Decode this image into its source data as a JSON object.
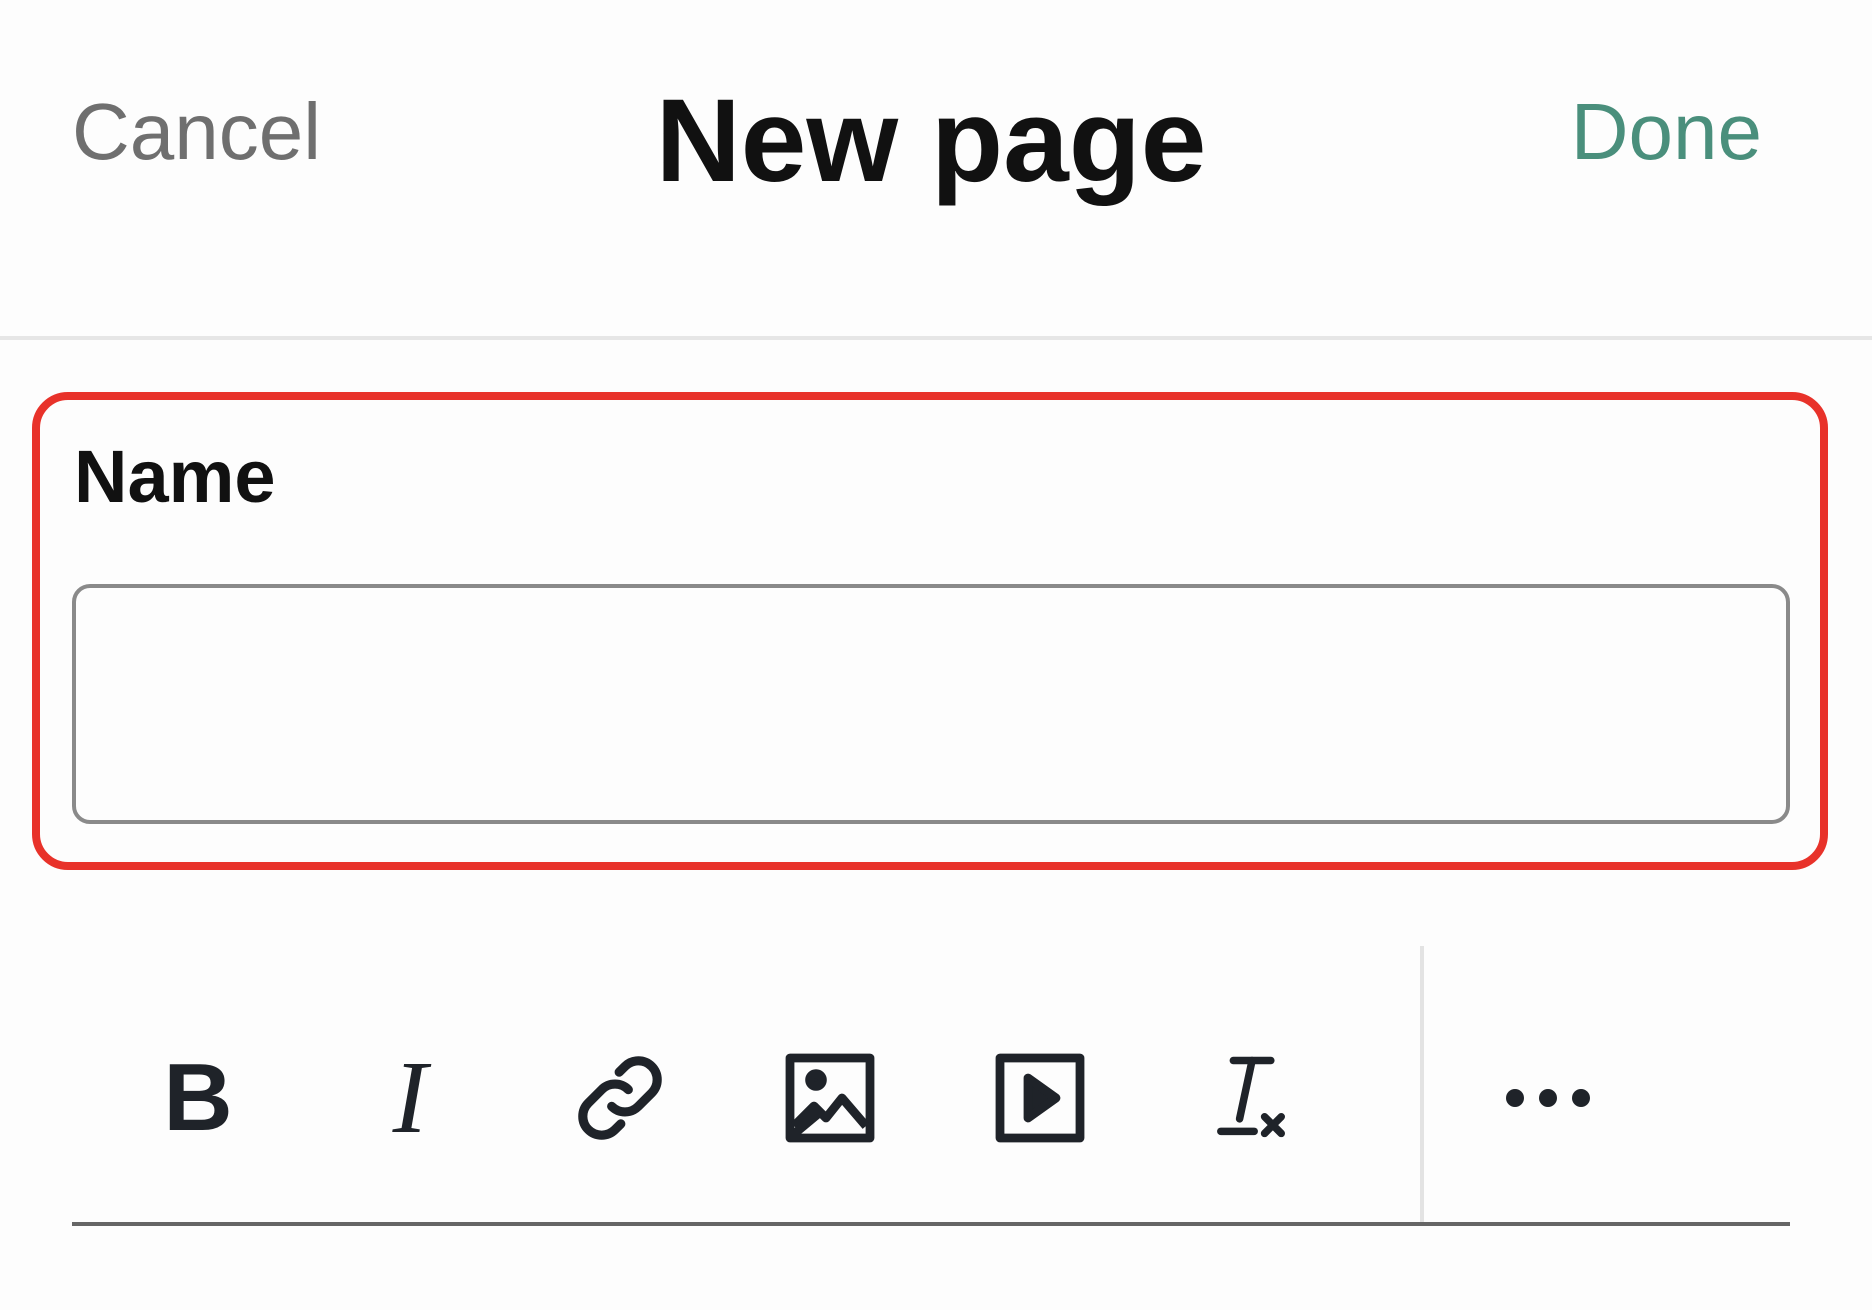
{
  "header": {
    "cancel_label": "Cancel",
    "title": "New page",
    "done_label": "Done"
  },
  "form": {
    "name_label": "Name",
    "name_value": "",
    "name_placeholder": ""
  },
  "toolbar": {
    "items": [
      {
        "icon": "bold-icon",
        "glyph": "B"
      },
      {
        "icon": "italic-icon",
        "glyph": "I"
      },
      {
        "icon": "link-icon"
      },
      {
        "icon": "image-icon"
      },
      {
        "icon": "video-icon"
      },
      {
        "icon": "clear-format-icon"
      },
      {
        "icon": "more-icon"
      }
    ]
  },
  "colors": {
    "accent": "#4a8f7c",
    "highlight": "#e8322a",
    "cancel": "#6f6f6f",
    "icon": "#1f2329"
  }
}
